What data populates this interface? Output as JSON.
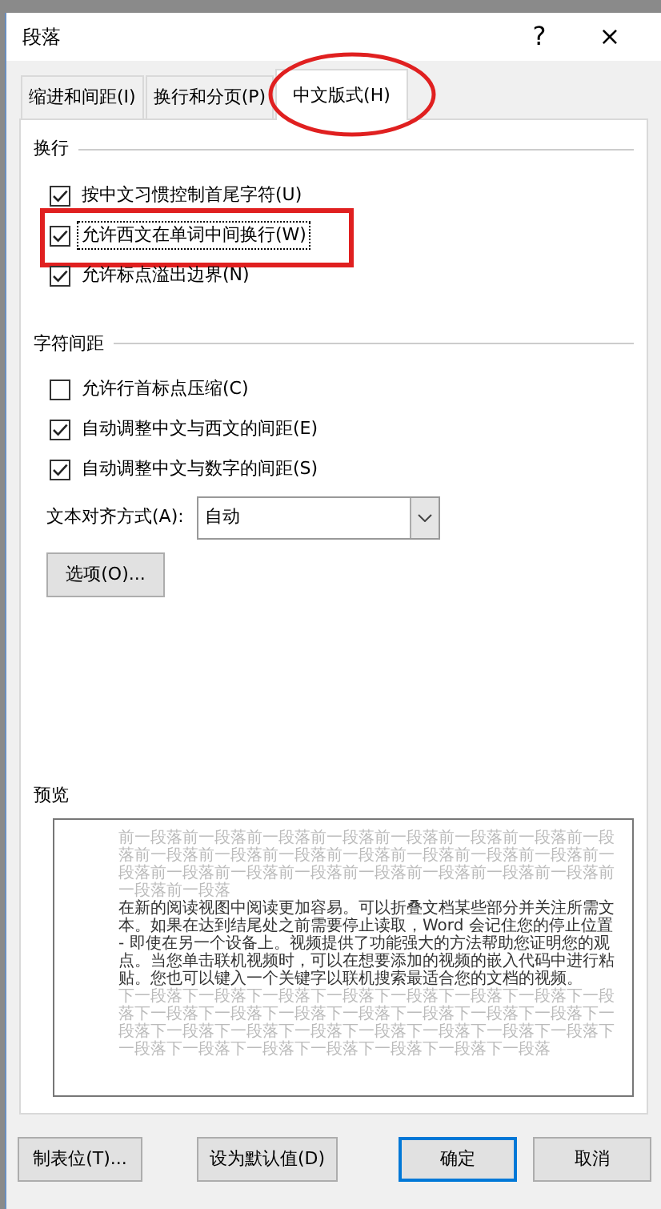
{
  "window": {
    "title": "段落",
    "help": "?",
    "close": "×"
  },
  "tabs": [
    {
      "label": "缩进和间距(I)",
      "selected": false,
      "annotated": false
    },
    {
      "label": "换行和分页(P)",
      "selected": false,
      "annotated": false
    },
    {
      "label": "中文版式(H)",
      "selected": true,
      "annotated": true
    }
  ],
  "sections": [
    {
      "title": "换行",
      "options": [
        {
          "label": "按中文习惯控制首尾字符(U)",
          "checked": true,
          "focused": false,
          "annotated": false
        },
        {
          "label": "允许西文在单词中间换行(W)",
          "checked": true,
          "focused": true,
          "annotated": true
        },
        {
          "label": "允许标点溢出边界(N)",
          "checked": true,
          "focused": false,
          "annotated": false
        }
      ]
    },
    {
      "title": "字符间距",
      "options": [
        {
          "label": "允许行首标点压缩(C)",
          "checked": false,
          "focused": false,
          "annotated": false
        },
        {
          "label": "自动调整中文与西文的间距(E)",
          "checked": true,
          "focused": false,
          "annotated": false
        },
        {
          "label": "自动调整中文与数字的间距(S)",
          "checked": true,
          "focused": false,
          "annotated": false
        }
      ]
    }
  ],
  "alignment": {
    "label": "文本对齐方式(A):",
    "value": "自动"
  },
  "options_button": "选项(O)...",
  "preview": {
    "title": "预览",
    "previous": "前一段落前一段落前一段落前一段落前一段落前一段落前一段落前一段落前一段落前一段落前一段落前一段落前一段落前一段落前一段落前一段落前一段落前一段落前一段落前一段落前一段落前一段落前一段落前一段落前一段落",
    "sample": "在新的阅读视图中阅读更加容易。可以折叠文档某些部分并关注所需文本。如果在达到结尾处之前需要停止读取，Word 会记住您的停止位置 - 即使在另一个设备上。视频提供了功能强大的方法帮助您证明您的观点。当您单击联机视频时，可以在想要添加的视频的嵌入代码中进行粘贴。您也可以键入一个关键字以联机搜索最适合您的文档的视频。",
    "next": "下一段落下一段落下一段落下一段落下一段落下一段落下一段落下一段落下一段落下一段落下一段落下一段落下一段落下一段落下一段落下一段落下一段落下一段落下一段落下一段落下一段落下一段落下一段落下一段落下一段落下一段落下一段落下一段落下一段落下一段落"
  },
  "buttons": [
    {
      "label": "制表位(T)...",
      "default": false
    },
    {
      "label": "设为默认值(D)",
      "default": false
    },
    {
      "label": "确定",
      "default": true
    },
    {
      "label": "取消",
      "default": false
    }
  ]
}
